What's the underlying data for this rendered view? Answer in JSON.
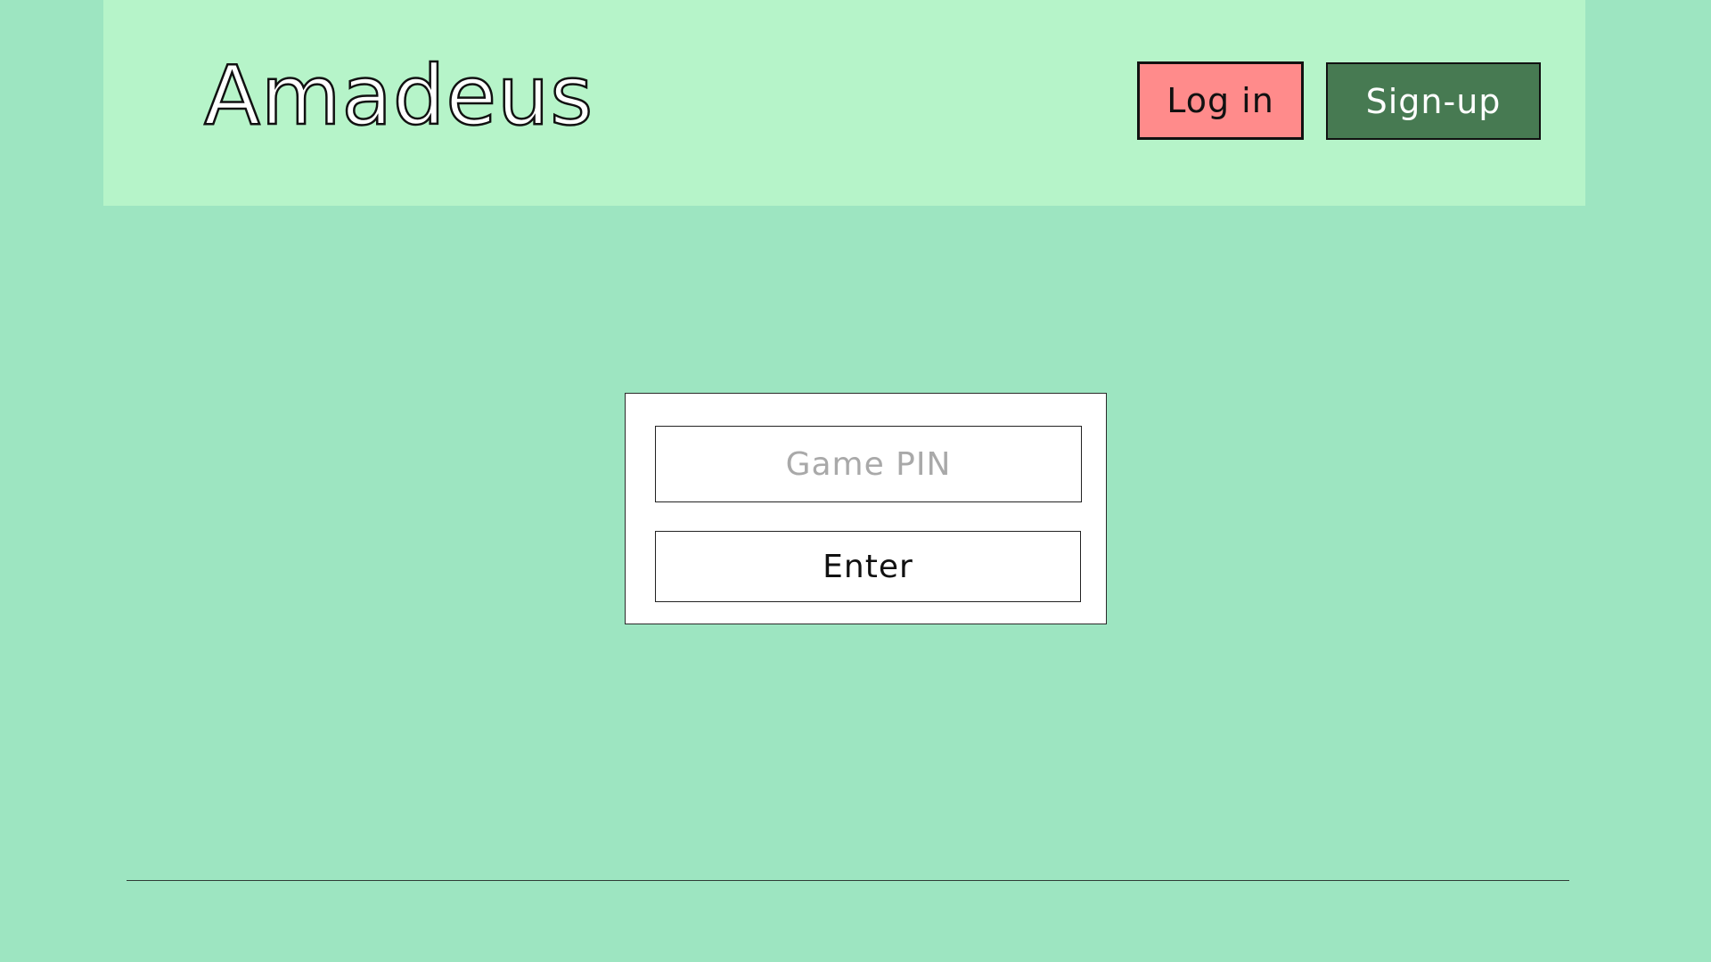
{
  "header": {
    "logo_text": "Amadeus",
    "login_label": "Log in",
    "signup_label": "Sign-up"
  },
  "join": {
    "pin_placeholder": "Game PIN",
    "pin_value": "",
    "enter_label": "Enter"
  },
  "colors": {
    "background": "#9de5c1",
    "header_bg": "#b6f4c9",
    "login_bg": "#ff8b8b",
    "signup_bg": "#477a52",
    "card_bg": "#ffffff",
    "placeholder": "#a9a9a9"
  }
}
